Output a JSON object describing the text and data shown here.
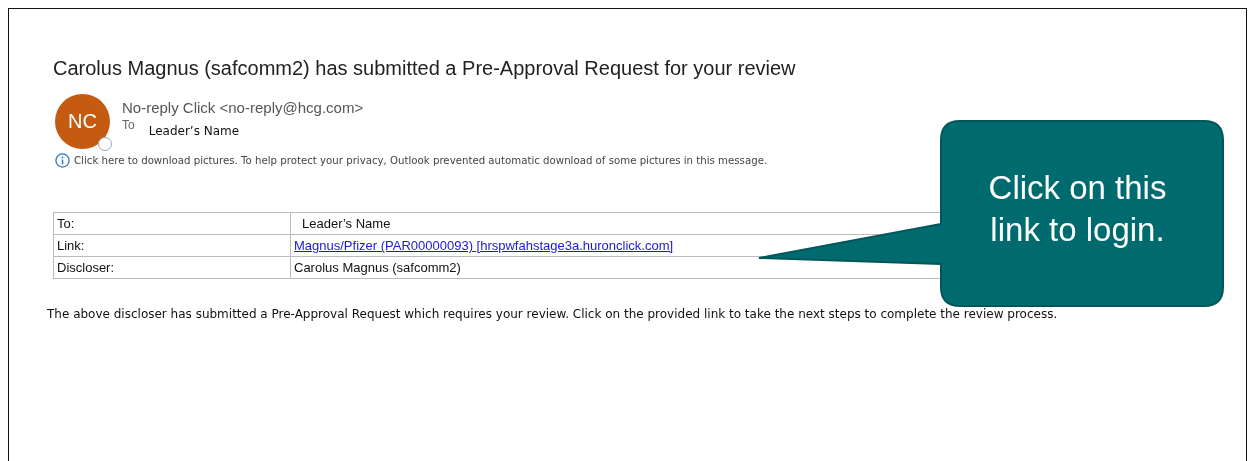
{
  "subject": "Carolus Magnus (safcomm2) has submitted a Pre-Approval Request for your review",
  "sender": {
    "initials": "NC",
    "line": "No-reply Click <no-reply@hcg.com>",
    "to_label": "To",
    "to": "Leader’s Name"
  },
  "info_bar": "Click here to download pictures. To help protect your privacy, Outlook prevented automatic download of some pictures in this message.",
  "table": {
    "rows": [
      {
        "label": "To:",
        "value": "Leader’s Name",
        "kind": "text"
      },
      {
        "label": "Link:",
        "value": "Magnus/Pfizer (PAR00000093) [hrspwfahstage3a.huronclick.com]",
        "kind": "link"
      },
      {
        "label": "Discloser:",
        "value": "Carolus Magnus (safcomm2)",
        "kind": "text"
      }
    ]
  },
  "body": "The above discloser has submitted a Pre-Approval Request which requires your review. Click on the provided link to take the next steps to complete the review process.",
  "callout": {
    "text_lines": [
      "Click on this",
      "link to login."
    ]
  }
}
